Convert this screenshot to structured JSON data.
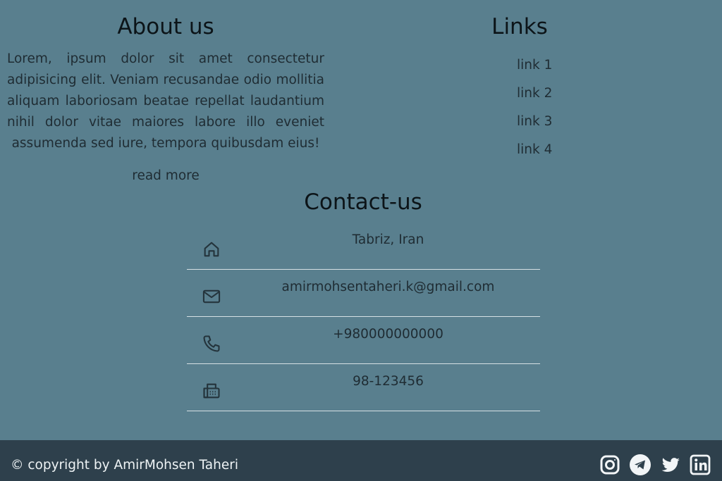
{
  "about": {
    "heading": "About us",
    "body": "Lorem, ipsum dolor sit amet consectetur adipisicing elit. Veniam recusandae odio mollitia aliquam laboriosam beatae repellat laudantium nihil dolor vitae maiores labore illo eveniet assumenda sed iure, tempora quibusdam eius!",
    "read_more": "read more"
  },
  "links": {
    "heading": "Links",
    "items": [
      "link 1",
      "link 2",
      "link 3",
      "link 4"
    ]
  },
  "contact": {
    "heading": "Contact-us",
    "rows": [
      {
        "icon": "home-icon",
        "value": "Tabriz, Iran"
      },
      {
        "icon": "mail-icon",
        "value": "amirmohsentaheri.k@gmail.com"
      },
      {
        "icon": "phone-icon",
        "value": "+980000000000"
      },
      {
        "icon": "fax-icon",
        "value": "98-123456"
      }
    ]
  },
  "footer": {
    "copyright": "© copyright by AmirMohsen Taheri",
    "socials": [
      "instagram-icon",
      "telegram-icon",
      "twitter-icon",
      "linkedin-icon"
    ]
  },
  "colors": {
    "background": "#597f8e",
    "footer": "#2e404c",
    "text": "#1f2c33",
    "footer_text": "#eef3f5"
  }
}
